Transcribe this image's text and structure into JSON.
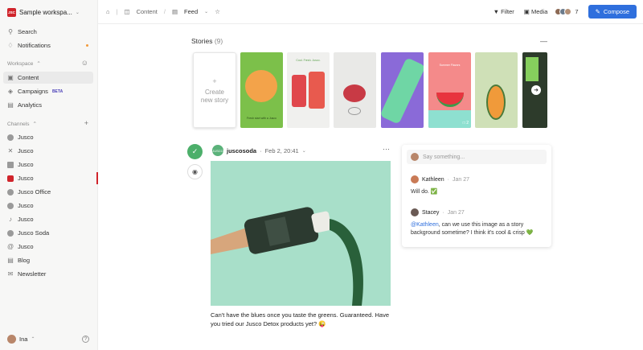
{
  "sidebar": {
    "workspace": {
      "logo": "JSC",
      "name": "Sample workspa..."
    },
    "search": "Search",
    "notifications": "Notifications",
    "workspace_section": "Workspace",
    "content": "Content",
    "campaigns": "Campaigns",
    "campaigns_badge": "BETA",
    "analytics": "Analytics",
    "channels_section": "Channels",
    "channels": [
      {
        "label": "Jusco",
        "icon": "facebook-icon",
        "color": "#9a9a9a"
      },
      {
        "label": "Jusco",
        "icon": "x-icon",
        "color": "#9a9a9a"
      },
      {
        "label": "Jusco",
        "icon": "linkedin-icon",
        "color": "#9a9a9a"
      },
      {
        "label": "Jusco",
        "icon": "instagram-icon",
        "color": "#d0242b"
      },
      {
        "label": "Jusco Office",
        "icon": "google-business-icon",
        "color": "#9a9a9a"
      },
      {
        "label": "Jusco",
        "icon": "youtube-icon",
        "color": "#9a9a9a"
      },
      {
        "label": "Jusco",
        "icon": "tiktok-icon",
        "color": "#9a9a9a"
      },
      {
        "label": "Jusco Soda",
        "icon": "pinterest-icon",
        "color": "#9a9a9a"
      },
      {
        "label": "Jusco",
        "icon": "threads-icon",
        "color": "#9a9a9a"
      },
      {
        "label": "Blog",
        "icon": "blog-icon",
        "color": "#9a9a9a"
      },
      {
        "label": "Newsletter",
        "icon": "mail-icon",
        "color": "#9a9a9a"
      }
    ],
    "user": "Ina"
  },
  "topbar": {
    "breadcrumb_content": "Content",
    "breadcrumb_feed": "Feed",
    "filter": "Filter",
    "media": "Media",
    "collaborators_count": "7",
    "compose": "Compose"
  },
  "stories": {
    "title": "Stories",
    "count": "(9)",
    "create_line1": "Create",
    "create_line2": "new story",
    "items": [
      {
        "bg": "#7cc04a",
        "caption": "Fresh start with a Jusco",
        "badge": ""
      },
      {
        "bg": "#f0f0ee",
        "caption": "Cool. Fresh. Jusco.",
        "badge": ""
      },
      {
        "bg": "#e9e9e7",
        "caption": "",
        "badge": ""
      },
      {
        "bg": "#8a6ad8",
        "caption": "",
        "badge": ""
      },
      {
        "bg": "#f48a8a",
        "caption": "Summer Flavors",
        "badge": "2"
      },
      {
        "bg": "#cfe0b7",
        "caption": "",
        "badge": ""
      },
      {
        "bg": "#2d3b2b",
        "caption": "",
        "badge": ""
      }
    ]
  },
  "post": {
    "handle": "juscosoda",
    "date": "Feb 2, 20:41",
    "caption": "Can't have the blues once you taste the greens. Guaranteed. Have you tried our Jusco Detox products yet? 😜"
  },
  "comments": {
    "placeholder": "Say something...",
    "items": [
      {
        "name": "Kathleen",
        "time": "Jan 27",
        "text": "Will do. ✅"
      },
      {
        "name": "Stacey",
        "time": "Jan 27",
        "mention": "@Kathleen",
        "text": ", can we use this image as a story background sometime? I think it's cool & crisp 💚"
      }
    ]
  }
}
